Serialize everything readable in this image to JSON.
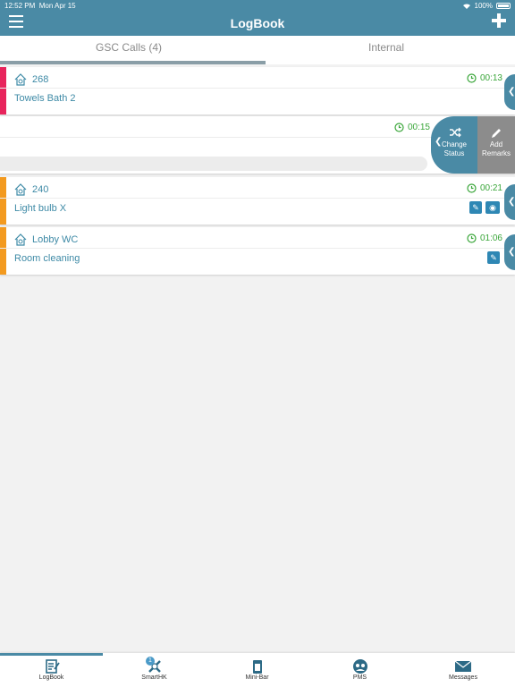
{
  "status_bar": {
    "time": "12:52 PM",
    "date": "Mon Apr 15",
    "battery": "100%"
  },
  "header": {
    "title": "LogBook"
  },
  "tabs": [
    {
      "label": "GSC Calls (4)",
      "active": true
    },
    {
      "label": "Internal",
      "active": false
    }
  ],
  "calls": [
    {
      "room": "268",
      "timer": "00:13",
      "description": "Towels Bath 2",
      "accent": "#e8245c"
    },
    {
      "room": "",
      "timer": "00:15",
      "description": "",
      "accent": ""
    },
    {
      "room": "240",
      "timer": "00:21",
      "description": "Light bulb X",
      "accent": "#f39a1f"
    },
    {
      "room": "Lobby WC",
      "timer": "01:06",
      "description": "Room cleaning",
      "accent": "#f39a1f"
    }
  ],
  "swipe_actions": {
    "change_status": "Change Status",
    "add_remarks": "Add Remarks"
  },
  "bottom_nav": [
    {
      "label": "LogBook",
      "icon": "logbook-icon"
    },
    {
      "label": "SmartHK",
      "icon": "smarthk-icon",
      "badge": "1"
    },
    {
      "label": "Mini-Bar",
      "icon": "minibar-icon"
    },
    {
      "label": "PMS",
      "icon": "pms-icon"
    },
    {
      "label": "Messages",
      "icon": "messages-icon"
    }
  ],
  "colors": {
    "header": "#4a8aa5",
    "timer": "#3aa63a",
    "link": "#3e8aa6"
  }
}
